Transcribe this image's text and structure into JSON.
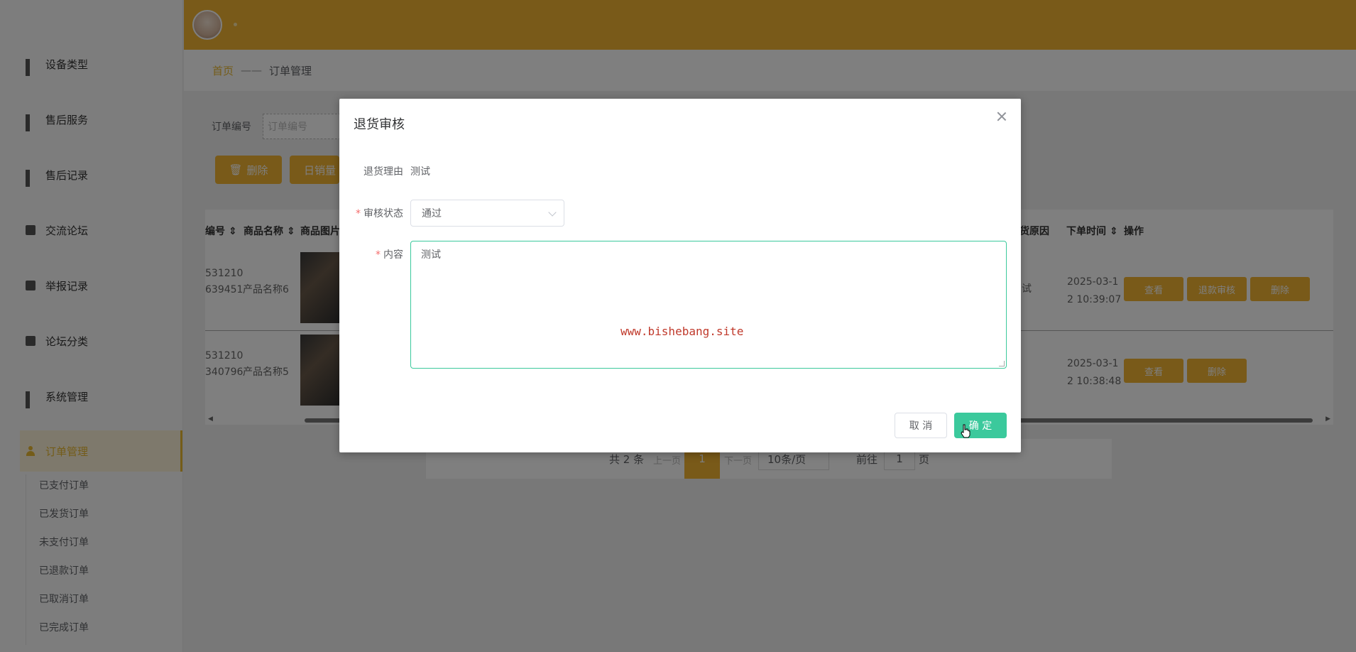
{
  "sidebar": {
    "items": [
      {
        "label": "设备类型",
        "icon": "grid-icon"
      },
      {
        "label": "售后服务",
        "icon": "grid-icon"
      },
      {
        "label": "售后记录",
        "icon": "grid-icon"
      },
      {
        "label": "交流论坛",
        "icon": "forum-icon"
      },
      {
        "label": "举报记录",
        "icon": "clipboard-icon"
      },
      {
        "label": "论坛分类",
        "icon": "briefcase-icon"
      },
      {
        "label": "系统管理",
        "icon": "grid-icon"
      },
      {
        "label": "订单管理",
        "icon": "user-icon"
      }
    ],
    "sub_items": [
      "已支付订单",
      "已发货订单",
      "未支付订单",
      "已退款订单",
      "已取消订单",
      "已完成订单"
    ]
  },
  "breadcrumb": {
    "home": "首页",
    "separator": "——",
    "current": "订单管理"
  },
  "search": {
    "label": "订单编号",
    "placeholder": "订单编号"
  },
  "toolbar": {
    "delete_label": "删除",
    "sales_label": "日销量"
  },
  "table": {
    "headers": [
      "编号",
      "商品名称",
      "商品图片",
      "货原因",
      "下单时间",
      "操作"
    ],
    "rows": [
      {
        "id_line1": "531210",
        "id_line2": "639451",
        "name": "产品名称6",
        "reason": "试",
        "time_line1": "2025-03-1",
        "time_line2": "2 10:39:07",
        "buttons": [
          "查看",
          "退款审核",
          "删除"
        ]
      },
      {
        "id_line1": "531210",
        "id_line2": "340796",
        "name": "产品名称5",
        "reason": "",
        "time_line1": "2025-03-1",
        "time_line2": "2 10:38:48",
        "buttons": [
          "查看",
          "删除"
        ]
      }
    ]
  },
  "pager": {
    "total": "共 2 条",
    "prev": "上一页",
    "current": "1",
    "next": "下一页",
    "size": "10条/页",
    "goto": "前往",
    "goto_value": "1",
    "page": "页"
  },
  "dialog": {
    "title": "退货审核",
    "reason_label": "退货理由",
    "reason_value": "测试",
    "status_label": "审核状态",
    "status_value": "通过",
    "content_label": "内容",
    "content_value": "测试",
    "watermark": "www.bishebang.site",
    "cancel_label": "取 消",
    "ok_label": "确 定"
  },
  "colors": {
    "accent": "#f2b532",
    "success": "#3bc99c",
    "required": "#f56c6c"
  }
}
